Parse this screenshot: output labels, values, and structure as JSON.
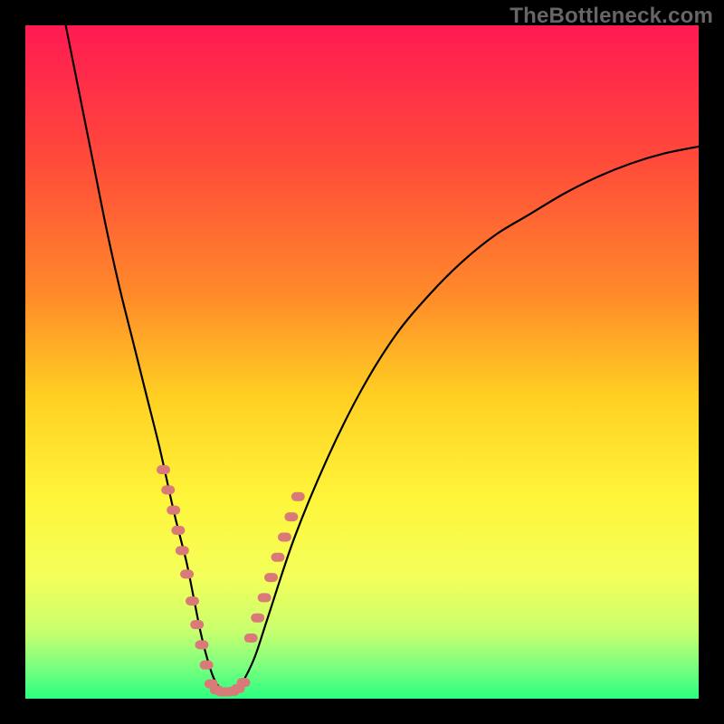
{
  "watermark": "TheBottleneck.com",
  "chart_data": {
    "type": "line",
    "title": "",
    "xlabel": "",
    "ylabel": "",
    "xlim": [
      0,
      100
    ],
    "ylim": [
      0,
      100
    ],
    "background_gradient": [
      {
        "offset": 0.0,
        "color": "#ff1a52"
      },
      {
        "offset": 0.2,
        "color": "#ff4a3a"
      },
      {
        "offset": 0.4,
        "color": "#ff8a2a"
      },
      {
        "offset": 0.55,
        "color": "#ffcf22"
      },
      {
        "offset": 0.7,
        "color": "#fff53a"
      },
      {
        "offset": 0.82,
        "color": "#f3ff5a"
      },
      {
        "offset": 0.9,
        "color": "#c8ff6e"
      },
      {
        "offset": 0.95,
        "color": "#7fff7f"
      },
      {
        "offset": 1.0,
        "color": "#2bff80"
      }
    ],
    "series": [
      {
        "name": "bottleneck-curve",
        "x": [
          6,
          8,
          10,
          12,
          14,
          16,
          18,
          20,
          22,
          23,
          24,
          25,
          26,
          27,
          28,
          29,
          30,
          31,
          32,
          34,
          36,
          40,
          45,
          50,
          55,
          60,
          65,
          70,
          75,
          80,
          85,
          90,
          95,
          100
        ],
        "y": [
          100,
          90,
          80,
          70,
          61,
          53,
          45,
          37,
          28,
          24,
          20,
          15,
          10,
          6,
          3,
          1.5,
          1,
          1,
          2,
          6,
          12,
          24,
          36,
          46,
          54,
          60,
          65,
          69,
          72,
          75,
          77.5,
          79.5,
          81,
          82
        ]
      }
    ],
    "markers": [
      {
        "name": "left-segment-dots",
        "x": [
          20.5,
          21.2,
          22.0,
          22.7,
          23.3,
          24.0,
          24.8,
          25.5,
          26.2,
          26.9
        ],
        "y": [
          34,
          31,
          28,
          25,
          22,
          18.5,
          14.5,
          11,
          8,
          5
        ]
      },
      {
        "name": "trough-dots",
        "x": [
          27.6,
          28.4,
          29.2,
          30.0,
          30.8,
          31.6,
          32.4
        ],
        "y": [
          2.2,
          1.3,
          1.0,
          1.0,
          1.1,
          1.5,
          2.4
        ]
      },
      {
        "name": "right-segment-dots",
        "x": [
          33.5,
          34.5,
          35.5,
          36.5,
          37.5,
          38.5,
          39.5,
          40.5
        ],
        "y": [
          9,
          12,
          15,
          18,
          21,
          24,
          27,
          30
        ]
      }
    ]
  }
}
